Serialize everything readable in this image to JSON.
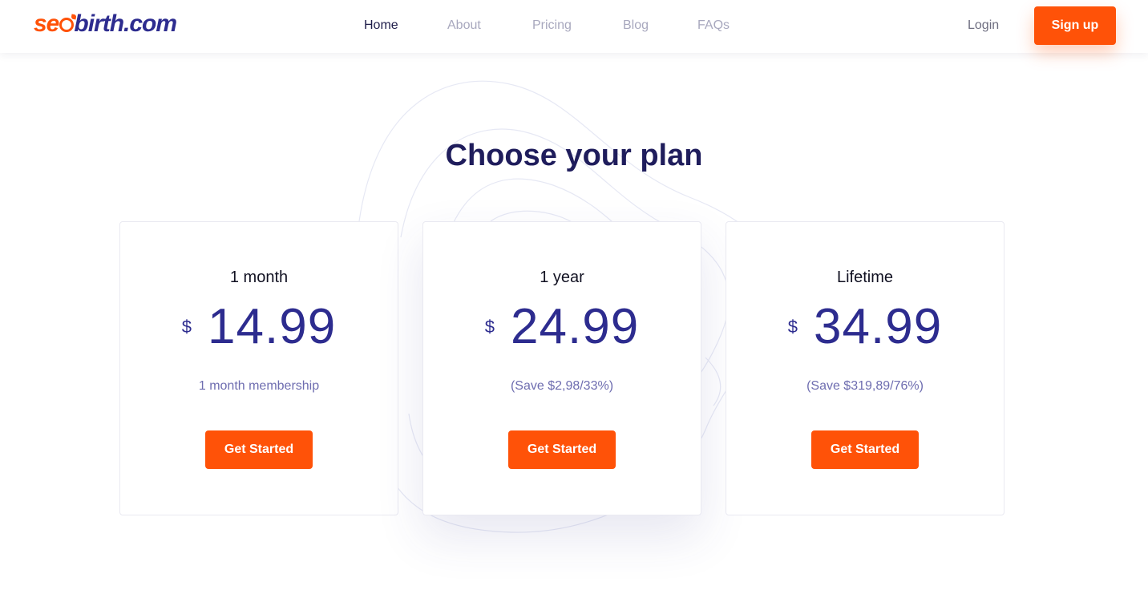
{
  "brand": {
    "logo_seo": "se",
    "logo_rest": "birth.com",
    "accent": "#ff5208",
    "primary": "#2d2c8f"
  },
  "nav": {
    "items": [
      {
        "label": "Home",
        "active": true
      },
      {
        "label": "About",
        "active": false
      },
      {
        "label": "Pricing",
        "active": false
      },
      {
        "label": "Blog",
        "active": false
      },
      {
        "label": "FAQs",
        "active": false
      }
    ],
    "login_label": "Login",
    "signup_label": "Sign up"
  },
  "pricing": {
    "title": "Choose your plan",
    "plans": [
      {
        "name": "1 month",
        "currency": "$",
        "amount": "14.99",
        "note": "1 month membership",
        "cta": "Get Started"
      },
      {
        "name": "1 year",
        "currency": "$",
        "amount": "24.99",
        "note": "(Save $2,98/33%)",
        "cta": "Get Started"
      },
      {
        "name": "Lifetime",
        "currency": "$",
        "amount": "34.99",
        "note": "(Save $319,89/76%)",
        "cta": "Get Started"
      }
    ]
  }
}
